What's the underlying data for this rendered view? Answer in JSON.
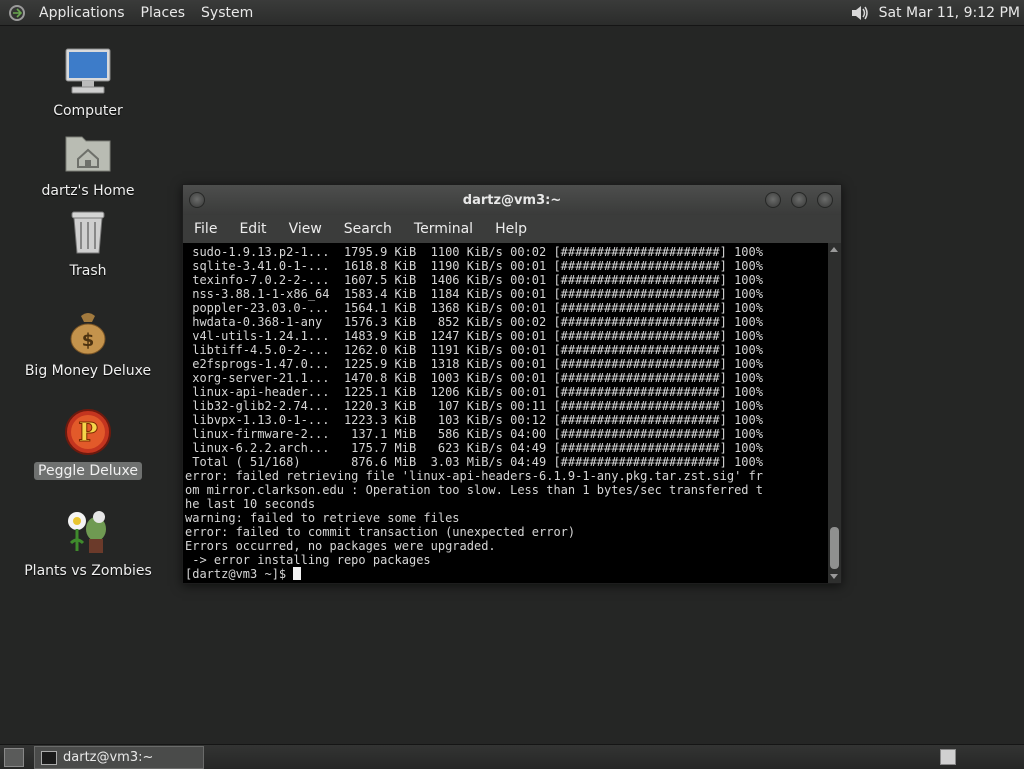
{
  "top_panel": {
    "menus": [
      "Applications",
      "Places",
      "System"
    ],
    "clock": "Sat Mar 11,  9:12 PM"
  },
  "desktop": {
    "icons": [
      {
        "label": "Computer",
        "icon": "computer-icon"
      },
      {
        "label": "dartz's Home",
        "icon": "home-folder-icon"
      },
      {
        "label": "Trash",
        "icon": "trash-icon"
      },
      {
        "label": "Big Money Deluxe",
        "icon": "money-bag-icon"
      },
      {
        "label": "Peggle Deluxe",
        "icon": "peggle-icon",
        "selected": true
      },
      {
        "label": "Plants vs Zombies",
        "icon": "plants-vs-zombies-icon"
      }
    ]
  },
  "terminal": {
    "title": "dartz@vm3:~",
    "menus": [
      "File",
      "Edit",
      "View",
      "Search",
      "Terminal",
      "Help"
    ],
    "lines": [
      " sudo-1.9.13.p2-1...  1795.9 KiB  1100 KiB/s 00:02 [######################] 100%",
      " sqlite-3.41.0-1-...  1618.8 KiB  1190 KiB/s 00:01 [######################] 100%",
      " texinfo-7.0.2-2-...  1607.5 KiB  1406 KiB/s 00:01 [######################] 100%",
      " nss-3.88.1-1-x86_64  1583.4 KiB  1184 KiB/s 00:01 [######################] 100%",
      " poppler-23.03.0-...  1564.1 KiB  1368 KiB/s 00:01 [######################] 100%",
      " hwdata-0.368-1-any   1576.3 KiB   852 KiB/s 00:02 [######################] 100%",
      " v4l-utils-1.24.1...  1483.9 KiB  1247 KiB/s 00:01 [######################] 100%",
      " libtiff-4.5.0-2-...  1262.0 KiB  1191 KiB/s 00:01 [######################] 100%",
      " e2fsprogs-1.47.0...  1225.9 KiB  1318 KiB/s 00:01 [######################] 100%",
      " xorg-server-21.1...  1470.8 KiB  1003 KiB/s 00:01 [######################] 100%",
      " linux-api-header...  1225.1 KiB  1206 KiB/s 00:01 [######################] 100%",
      " lib32-glib2-2.74...  1220.3 KiB   107 KiB/s 00:11 [######################] 100%",
      " libvpx-1.13.0-1-...  1223.3 KiB   103 KiB/s 00:12 [######################] 100%",
      " linux-firmware-2...   137.1 MiB   586 KiB/s 04:00 [######################] 100%",
      " linux-6.2.2.arch...   175.7 MiB   623 KiB/s 04:49 [######################] 100%",
      " Total ( 51/168)       876.6 MiB  3.03 MiB/s 04:49 [######################] 100%",
      "error: failed retrieving file 'linux-api-headers-6.1.9-1-any.pkg.tar.zst.sig' fr",
      "om mirror.clarkson.edu : Operation too slow. Less than 1 bytes/sec transferred t",
      "he last 10 seconds",
      "warning: failed to retrieve some files",
      "error: failed to commit transaction (unexpected error)",
      "Errors occurred, no packages were upgraded.",
      " -> error installing repo packages"
    ],
    "prompt": "[dartz@vm3 ~]$ "
  },
  "bottom_panel": {
    "task_label": "dartz@vm3:~"
  }
}
